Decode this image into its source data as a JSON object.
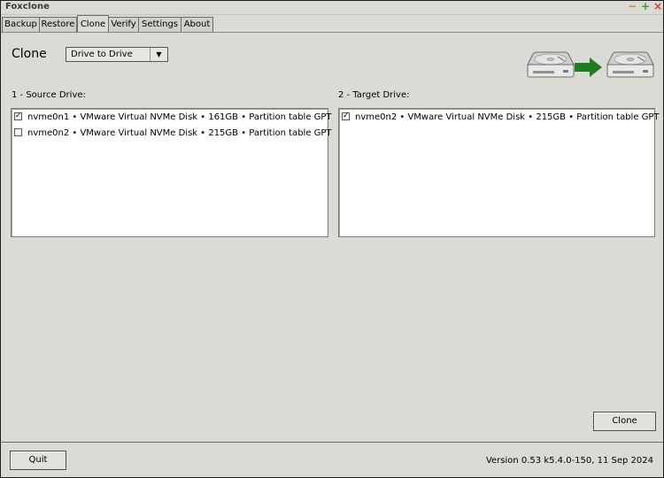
{
  "window": {
    "title": "Foxclone",
    "controls": {
      "minimize": "−",
      "maximize": "+",
      "close": "×"
    }
  },
  "tabs": [
    {
      "label": "Backup",
      "active": false
    },
    {
      "label": "Restore",
      "active": false
    },
    {
      "label": "Clone",
      "active": true
    },
    {
      "label": "Verify",
      "active": false
    },
    {
      "label": "Settings",
      "active": false
    },
    {
      "label": "About",
      "active": false
    }
  ],
  "clone": {
    "heading": "Clone",
    "mode_selected": "Drive to Drive",
    "graphic_icons": [
      "hard-drive-icon",
      "arrow-right-icon",
      "hard-drive-icon"
    ]
  },
  "source": {
    "label": "1 - Source Drive:",
    "items": [
      {
        "text": "nvme0n1 • VMware Virtual NVMe Disk • 161GB • Partition table GPT",
        "checked": true
      },
      {
        "text": "nvme0n2 • VMware Virtual NVMe Disk • 215GB • Partition table GPT",
        "checked": false
      }
    ]
  },
  "target": {
    "label": "2 - Target Drive:",
    "items": [
      {
        "text": "nvme0n2 • VMware Virtual NVMe Disk • 215GB • Partition table GPT",
        "checked": true
      }
    ]
  },
  "actions": {
    "clone_button": "Clone",
    "quit_button": "Quit"
  },
  "footer": {
    "version": "Version 0.53 k5.4.0-150, 11 Sep 2024"
  },
  "colors": {
    "background": "#dcdad5",
    "arrow_green": "#1e7d1e",
    "close_red": "#d83a2a",
    "maximize_green": "#2e9e2e",
    "minimize_orange": "#e07b1a"
  }
}
